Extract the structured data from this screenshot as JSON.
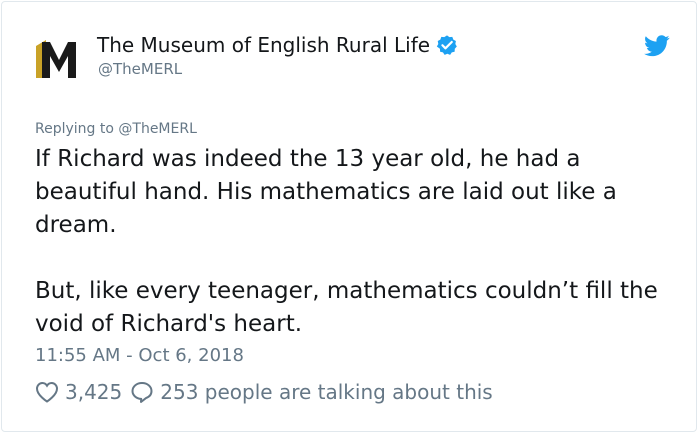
{
  "account": {
    "display_name": "The Museum of English Rural Life",
    "handle": "@TheMERL",
    "avatar_letter": "M"
  },
  "reply": {
    "prefix": "Replying to",
    "target": "@TheMERL"
  },
  "tweet": {
    "paragraph_1": "If Richard was indeed the 13 year old, he had a beautiful hand. His mathematics are laid out like a dream.",
    "paragraph_2": "But, like every teenager, mathematics couldn’t fill the void of Richard's heart.",
    "timestamp": "11:55 AM - Oct 6, 2018"
  },
  "stats": {
    "likes": "3,425",
    "talking": "253 people are talking about this"
  },
  "colors": {
    "twitter_blue": "#1da1f2",
    "muted": "#657786",
    "text": "#14171a",
    "logo_gold": "#c9a227"
  },
  "icons": [
    "merl-logo-icon",
    "verified-badge-icon",
    "twitter-bird-icon",
    "heart-icon",
    "speech-bubble-icon"
  ]
}
